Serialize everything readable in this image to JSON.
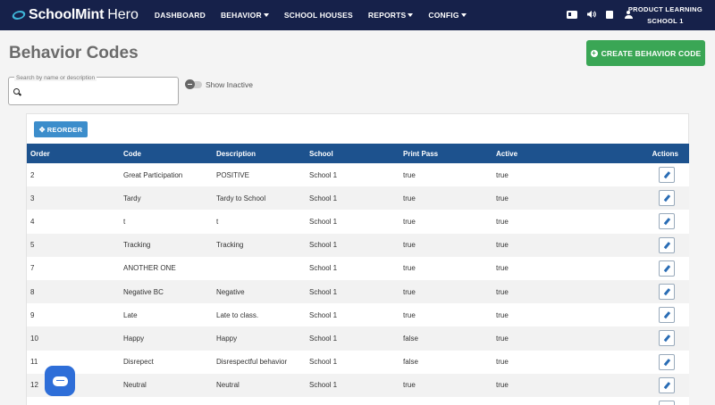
{
  "navbar": {
    "logo_bold": "SchoolMint",
    "logo_light": "Hero",
    "items": [
      {
        "label": "DASHBOARD",
        "dropdown": false
      },
      {
        "label": "BEHAVIOR",
        "dropdown": true
      },
      {
        "label": "SCHOOL HOUSES",
        "dropdown": false
      },
      {
        "label": "REPORTS",
        "dropdown": true
      },
      {
        "label": "CONFIG",
        "dropdown": true
      }
    ],
    "icons": [
      "id-card-icon",
      "speaker-icon",
      "calendar-icon",
      "user-icon"
    ],
    "school_line1": "PRODUCT LEARNING",
    "school_line2": "SCHOOL 1"
  },
  "page": {
    "title": "Behavior Codes",
    "create_button": "CREATE BEHAVIOR CODE"
  },
  "search": {
    "label": "Search by name or description",
    "value": "",
    "placeholder": ""
  },
  "toggle": {
    "label": "Show Inactive",
    "on": false
  },
  "reorder_button": "REORDER",
  "table": {
    "headers": [
      "Order",
      "Code",
      "Description",
      "School",
      "Print Pass",
      "Active",
      "Actions"
    ],
    "rows": [
      {
        "order": "2",
        "code": "Great Participation",
        "description": "POSITIVE",
        "school": "School 1",
        "print_pass": "true",
        "active": "true"
      },
      {
        "order": "3",
        "code": "Tardy",
        "description": "Tardy to School",
        "school": "School 1",
        "print_pass": "true",
        "active": "true"
      },
      {
        "order": "4",
        "code": "t",
        "description": "t",
        "school": "School 1",
        "print_pass": "true",
        "active": "true"
      },
      {
        "order": "5",
        "code": "Tracking",
        "description": "Tracking",
        "school": "School 1",
        "print_pass": "true",
        "active": "true"
      },
      {
        "order": "7",
        "code": "ANOTHER ONE",
        "description": "",
        "school": "School 1",
        "print_pass": "true",
        "active": "true"
      },
      {
        "order": "8",
        "code": "Negative BC",
        "description": "Negative",
        "school": "School 1",
        "print_pass": "true",
        "active": "true"
      },
      {
        "order": "9",
        "code": "Late",
        "description": "Late to class.",
        "school": "School 1",
        "print_pass": "true",
        "active": "true"
      },
      {
        "order": "10",
        "code": "Happy",
        "description": "Happy",
        "school": "School 1",
        "print_pass": "false",
        "active": "true"
      },
      {
        "order": "11",
        "code": "Disrepect",
        "description": "Disrespectful behavior",
        "school": "School 1",
        "print_pass": "false",
        "active": "true"
      },
      {
        "order": "12",
        "code": "Neutral",
        "description": "Neutral",
        "school": "School 1",
        "print_pass": "true",
        "active": "true"
      },
      {
        "order": "",
        "code": "",
        "description": "",
        "school": "",
        "print_pass": "",
        "active": ""
      }
    ]
  },
  "colors": {
    "navbar": "#16214a",
    "create_button": "#3aa655",
    "reorder_button": "#3c8dcb",
    "table_header": "#1d528e",
    "chat_bubble": "#2e6ed8"
  }
}
